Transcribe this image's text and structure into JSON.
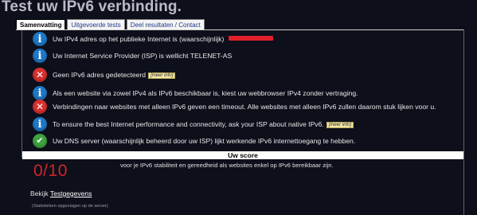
{
  "page": {
    "title": "Test uw IPv6 verbinding."
  },
  "tabs": [
    {
      "label": "Samenvatting",
      "active": true
    },
    {
      "label": "Uitgevoerde tests",
      "active": false
    },
    {
      "label": "Deel resultaten / Contact",
      "active": false
    }
  ],
  "results": [
    {
      "status": "info",
      "icon": "info-icon",
      "text": "Uw IPv4 adres op het publieke Internet is (waarschijnlijk) "
    },
    {
      "status": "info",
      "icon": "info-icon",
      "text": "Uw Internet Service Provider (ISP) is wellicht TELENET-AS"
    },
    {
      "status": "error",
      "icon": "error-icon",
      "text": "Geen IPv6 adres gedetecteerd",
      "more": "[meer info]"
    },
    {
      "status": "info",
      "icon": "info-icon",
      "text": "Als een website via zowel IPv4 als IPv6 beschikbaar is, kiest uw webbrowser IPv4 zonder vertraging."
    },
    {
      "status": "error",
      "icon": "error-icon",
      "text": "Verbindingen naar websites met alleen IPv6 geven een timeout. Alle websites met alleen IPv6 zullen daarom stuk lijken voor u."
    },
    {
      "status": "info",
      "icon": "info-icon",
      "text": "To ensure the best Internet performance and connectivity, ask your ISP about native IPv6.",
      "more": "[meer info]"
    },
    {
      "status": "ok",
      "icon": "check-icon",
      "text": "Uw DNS server (waarschijnlijk beheerd door uw ISP) lijkt werkende IPv6 internettoegang te hebben."
    }
  ],
  "score": {
    "header": "Uw score",
    "value": "0/10",
    "description": "voor je IPv6 stabiliteit en gereedheid als websites enkel op IPv6 bereikbaar zijn."
  },
  "details": {
    "prefix": "Bekijk ",
    "link": "Testgegevens"
  },
  "footnote": "(Statistieken opgeslagen op de server)",
  "colors": {
    "info": "#1f78c8",
    "error": "#d9312f",
    "ok": "#3ea33f",
    "score": "#d1262b",
    "background": "#0d0f1a"
  }
}
